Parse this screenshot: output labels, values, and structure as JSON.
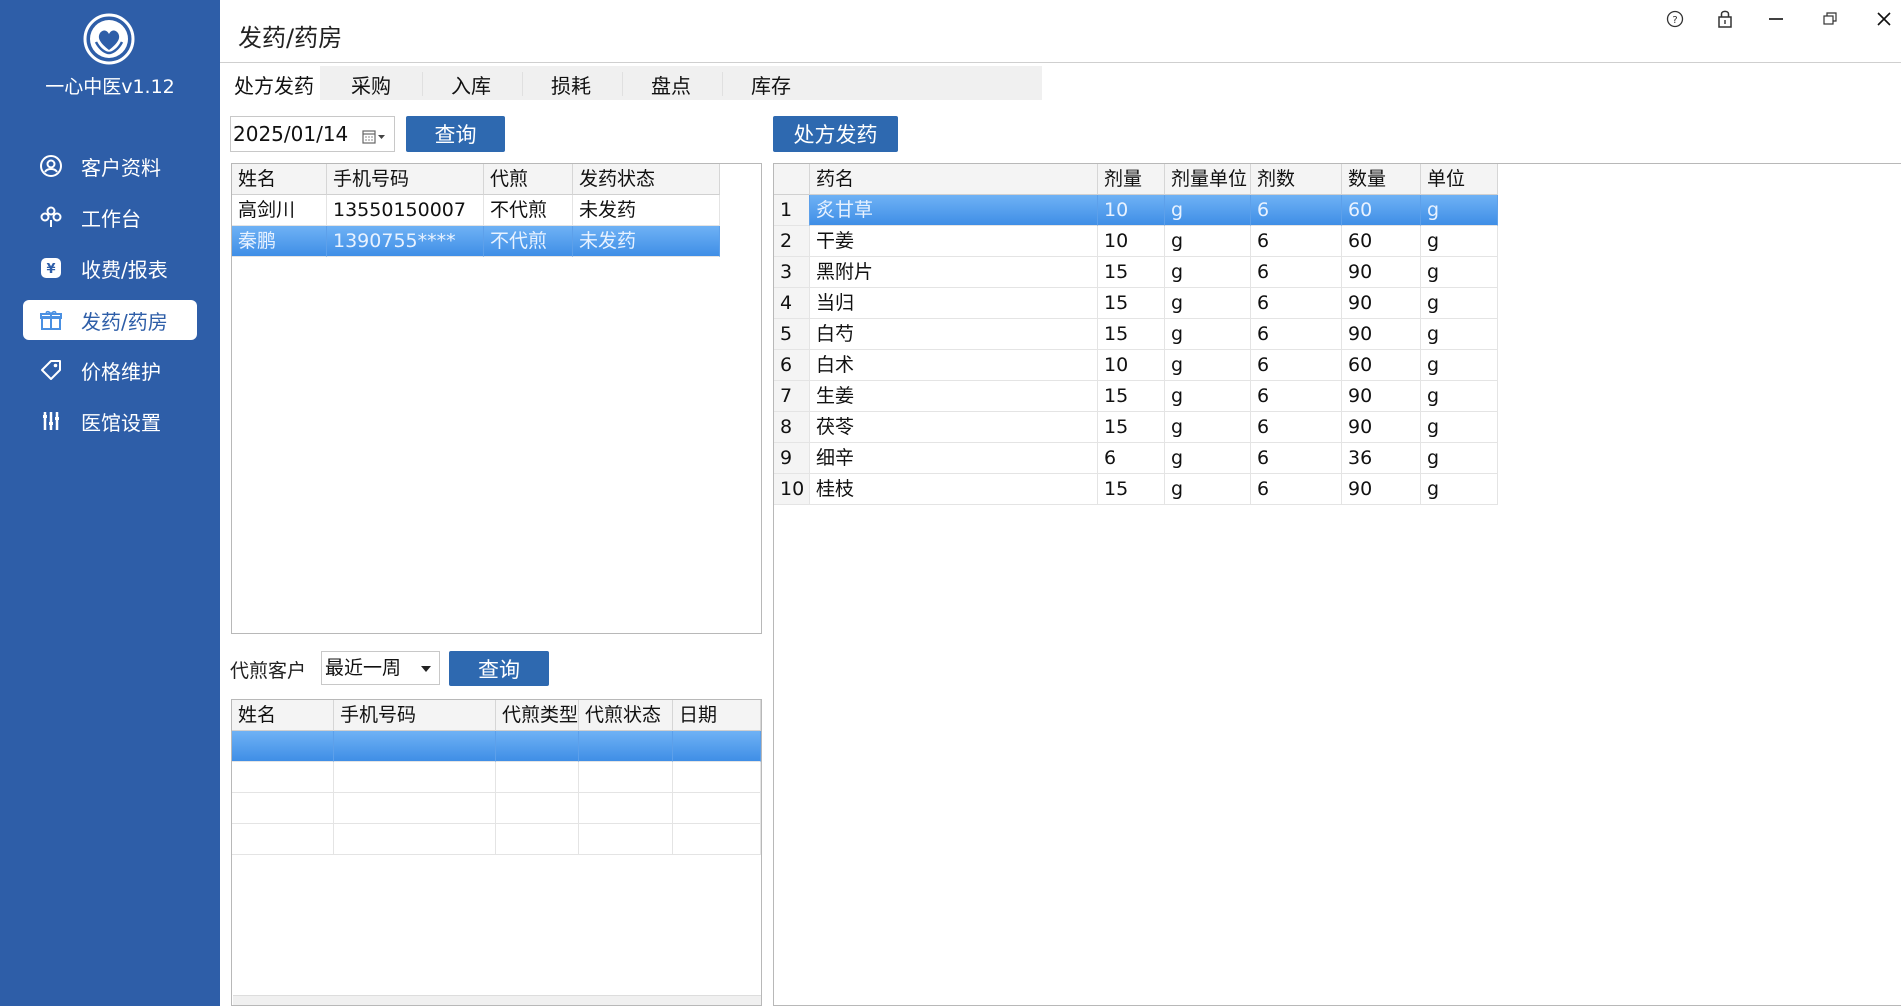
{
  "app": {
    "name": "一心中医v1.12",
    "page_title": "发药/药房"
  },
  "sidebar": {
    "items": [
      {
        "label": "客户资料",
        "icon": "user-circle-icon"
      },
      {
        "label": "工作台",
        "icon": "workbench-icon"
      },
      {
        "label": "收费/报表",
        "icon": "yen-icon"
      },
      {
        "label": "发药/药房",
        "icon": "gift-icon",
        "active": true
      },
      {
        "label": "价格维护",
        "icon": "price-tag-icon"
      },
      {
        "label": "医馆设置",
        "icon": "settings-sliders-icon"
      }
    ]
  },
  "tabs": [
    {
      "label": "处方发药",
      "active": true
    },
    {
      "label": "采购"
    },
    {
      "label": "入库"
    },
    {
      "label": "损耗"
    },
    {
      "label": "盘点"
    },
    {
      "label": "库存"
    }
  ],
  "query_panel": {
    "date_value": "2025/01/14",
    "query_button": "查询",
    "columns": [
      "姓名",
      "手机号码",
      "代煎",
      "发药状态"
    ],
    "rows": [
      [
        "高剑川",
        "13550150007",
        "不代煎",
        "未发药"
      ],
      [
        "秦鹏",
        "1390755****",
        "不代煎",
        "未发药"
      ]
    ],
    "selected_row": 1
  },
  "decoction_panel": {
    "label": "代煎客户",
    "period_value": "最近一周",
    "query_button": "查询",
    "columns": [
      "姓名",
      "手机号码",
      "代煎类型",
      "代煎状态",
      "日期"
    ]
  },
  "prescription": {
    "button": "处方发药",
    "columns": [
      "药名",
      "剂量",
      "剂量单位",
      "剂数",
      "数量",
      "单位"
    ],
    "rows": [
      [
        "1",
        "炙甘草",
        "10",
        "g",
        "6",
        "60",
        "g"
      ],
      [
        "2",
        "干姜",
        "10",
        "g",
        "6",
        "60",
        "g"
      ],
      [
        "3",
        "黑附片",
        "15",
        "g",
        "6",
        "90",
        "g"
      ],
      [
        "4",
        "当归",
        "15",
        "g",
        "6",
        "90",
        "g"
      ],
      [
        "5",
        "白芍",
        "15",
        "g",
        "6",
        "90",
        "g"
      ],
      [
        "6",
        "白术",
        "10",
        "g",
        "6",
        "60",
        "g"
      ],
      [
        "7",
        "生姜",
        "15",
        "g",
        "6",
        "90",
        "g"
      ],
      [
        "8",
        "茯苓",
        "15",
        "g",
        "6",
        "90",
        "g"
      ],
      [
        "9",
        "细辛",
        "6",
        "g",
        "6",
        "36",
        "g"
      ],
      [
        "10",
        "桂枝",
        "15",
        "g",
        "6",
        "90",
        "g"
      ]
    ],
    "selected_row": 0
  },
  "colors": {
    "sidebar": "#2e5ea8",
    "button": "#2e69b0",
    "selection": "#4b98ec"
  }
}
